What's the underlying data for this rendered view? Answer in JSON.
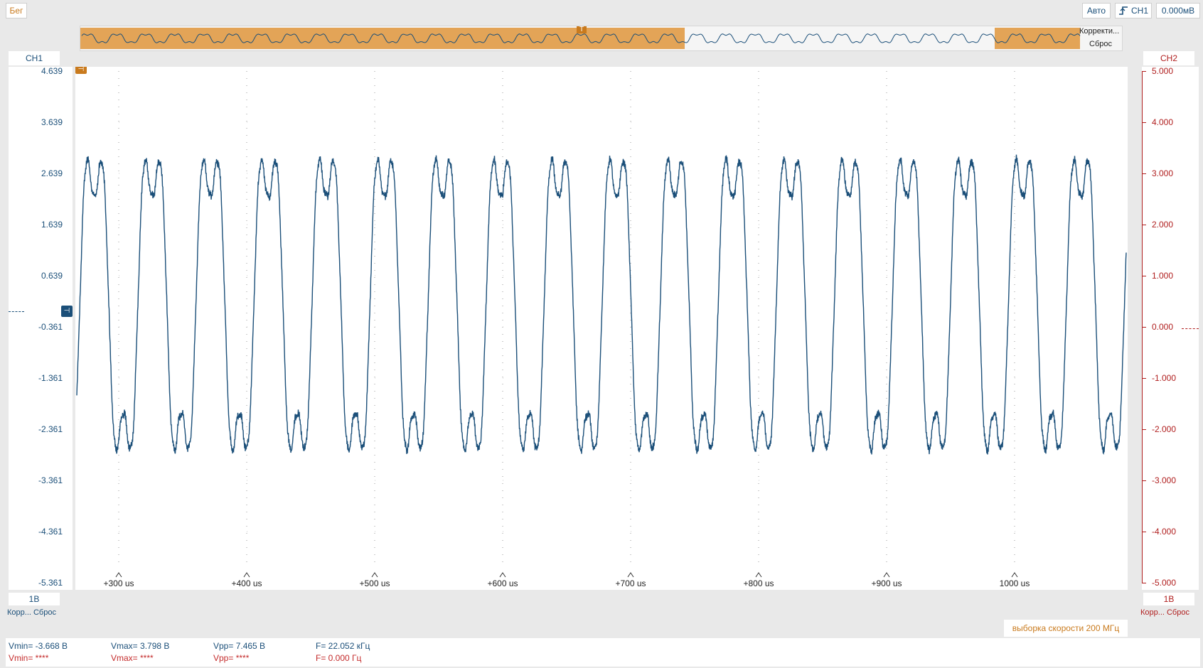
{
  "toolbar": {
    "run_label": "Бег",
    "trigger_mode": "Авто",
    "trigger_channel": "CH1",
    "trigger_level": "0.000мВ"
  },
  "overview": {
    "adjust_label": "Корректи...",
    "reset_label": "Сброс",
    "trigger_marker": "T"
  },
  "ch1": {
    "name": "CH1",
    "scale": "1В",
    "adjust": "Корр... Сброс",
    "y_labels": [
      "4.639",
      "3.639",
      "2.639",
      "1.639",
      "0.639",
      "-0.361",
      "-1.361",
      "-2.361",
      "-3.361",
      "-4.361",
      "-5.361"
    ]
  },
  "ch2": {
    "name": "CH2",
    "scale": "1В",
    "adjust": "Корр... Сброс",
    "y_labels": [
      "5.000",
      "4.000",
      "3.000",
      "2.000",
      "1.000",
      "0.000",
      "-1.000",
      "-2.000",
      "-3.000",
      "-4.000",
      "-5.000"
    ]
  },
  "x_axis": {
    "labels": [
      "+300 us",
      "+400 us",
      "+500 us",
      "+600 us",
      "+700 us",
      "+800 us",
      "+900 us"
    ],
    "end_label": "1000 us"
  },
  "sample_rate": "выборка скорости 200 МГц",
  "measurements": {
    "ch1": {
      "vmin": "Vmin= -3.668 В",
      "vmax": "Vmax= 3.798 В",
      "vpp": "Vpp= 7.465 В",
      "freq": "F= 22.052 кГц"
    },
    "ch2": {
      "vmin": "Vmin= ****",
      "vmax": "Vmax= ****",
      "vpp": "Vpp= ****",
      "freq": "F= 0.000 Гц"
    }
  },
  "colors": {
    "ch1": "#1b4f79",
    "ch2": "#b01e1e",
    "accent": "#c97a1d",
    "overview_fill": "#e3a457"
  },
  "chart_data": {
    "type": "line",
    "series": [
      {
        "name": "CH1",
        "frequency_khz": 22.052,
        "vmin": -3.668,
        "vmax": 3.798,
        "vpp": 7.465
      }
    ],
    "xlabel": "",
    "ylabel": "",
    "ylim": [
      -5.361,
      4.639
    ],
    "x_ticks": [
      "+300 us",
      "+400 us",
      "+500 us",
      "+600 us",
      "+700 us",
      "+800 us",
      "+900 us",
      "1000 us"
    ]
  }
}
